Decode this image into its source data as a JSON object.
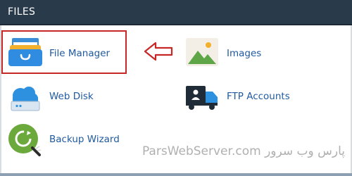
{
  "section": {
    "title": "FILES"
  },
  "items": [
    {
      "label": "File Manager",
      "icon": "file-manager-icon"
    },
    {
      "label": "Images",
      "icon": "images-icon"
    },
    {
      "label": "Web Disk",
      "icon": "web-disk-icon"
    },
    {
      "label": "FTP Accounts",
      "icon": "ftp-accounts-icon"
    },
    {
      "label": "Backup Wizard",
      "icon": "backup-wizard-icon"
    }
  ],
  "watermark": {
    "text": "ParsWebServer.com  پارس وب سرور"
  },
  "colors": {
    "header_bg": "#293a4a",
    "link": "#1f5aa0",
    "highlight": "#c62828"
  }
}
